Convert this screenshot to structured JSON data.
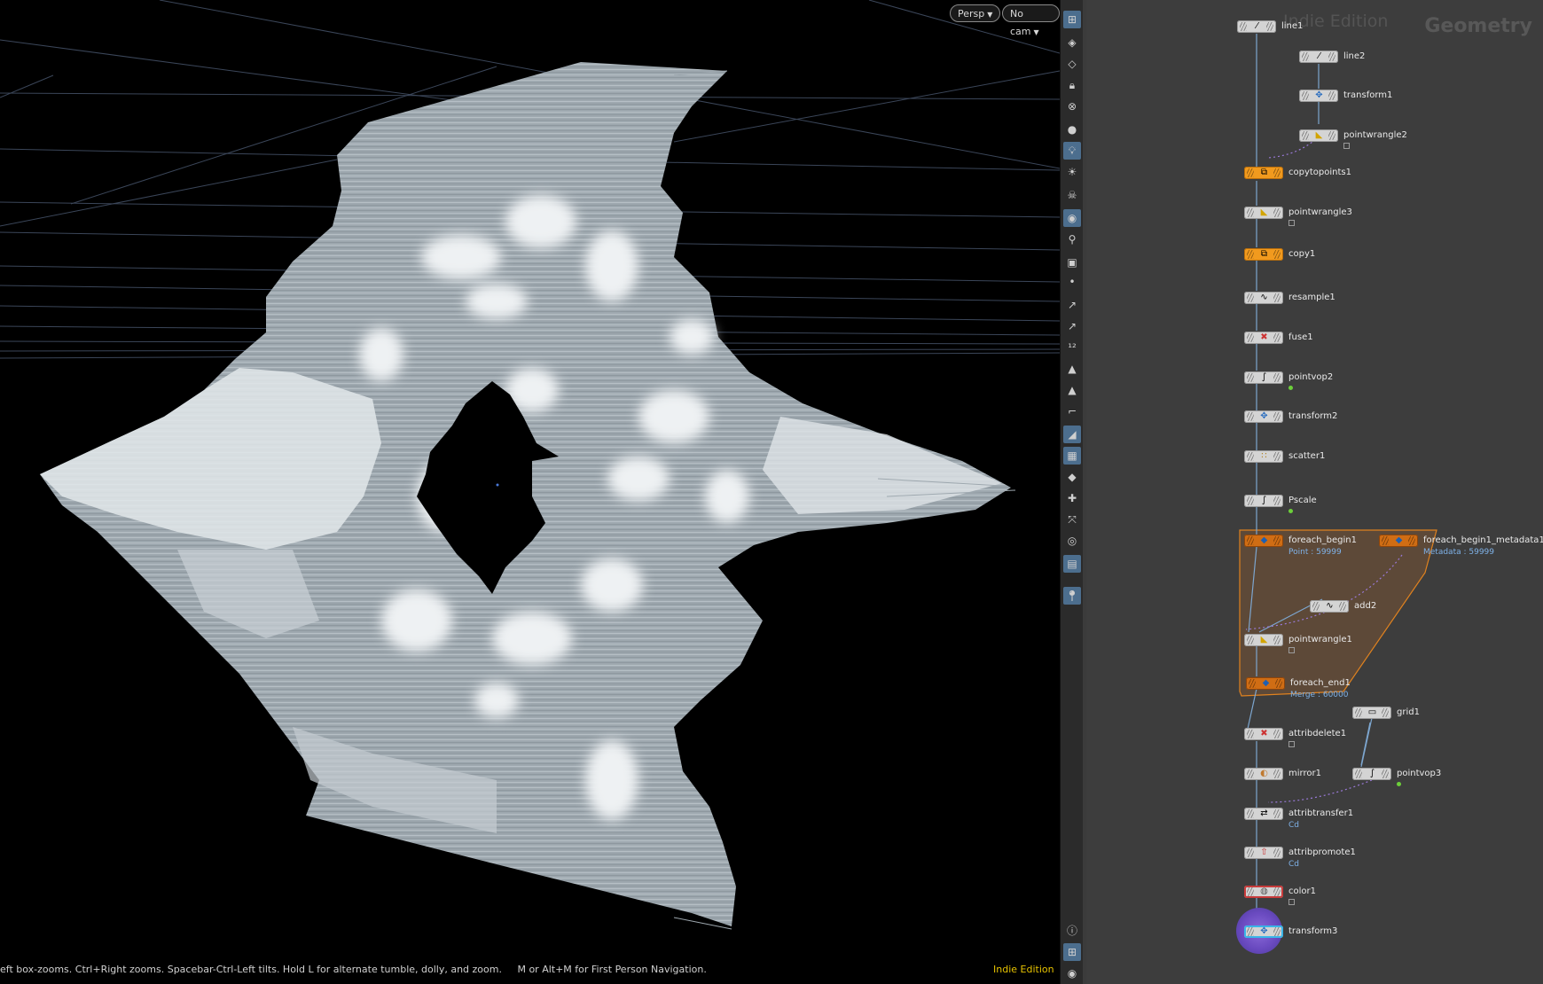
{
  "viewport": {
    "persp_label": "Persp",
    "cam_label": "No cam",
    "status_hint": "eft box-zooms. Ctrl+Right zooms. Spacebar-Ctrl-Left tilts. Hold L for alternate tumble, dolly, and zoom.     M or Alt+M for First Person Navigation.",
    "edition": "Indie Edition"
  },
  "network": {
    "title": "Geometry",
    "watermark": "Indie Edition",
    "nodes": {
      "line1": {
        "label": "line1"
      },
      "line2": {
        "label": "line2"
      },
      "transform1": {
        "label": "transform1"
      },
      "pointwrangle2": {
        "label": "pointwrangle2"
      },
      "copytopoints1": {
        "label": "copytopoints1"
      },
      "pointwrangle3": {
        "label": "pointwrangle3"
      },
      "copy1": {
        "label": "copy1"
      },
      "resample1": {
        "label": "resample1"
      },
      "fuse1": {
        "label": "fuse1"
      },
      "pointvop2": {
        "label": "pointvop2"
      },
      "transform2": {
        "label": "transform2"
      },
      "scatter1": {
        "label": "scatter1"
      },
      "pscale": {
        "label": "Pscale"
      },
      "foreach_begin1": {
        "label": "foreach_begin1",
        "sub": "Point : 59999"
      },
      "foreach_begin1_metadata1": {
        "label": "foreach_begin1_metadata1",
        "sub": "Metadata : 59999"
      },
      "add2": {
        "label": "add2"
      },
      "pointwrangle1": {
        "label": "pointwrangle1"
      },
      "foreach_end1": {
        "label": "foreach_end1",
        "sub": "Merge : 60000"
      },
      "grid1": {
        "label": "grid1"
      },
      "attribdelete1": {
        "label": "attribdelete1"
      },
      "mirror1": {
        "label": "mirror1"
      },
      "pointvop3": {
        "label": "pointvop3"
      },
      "attribtransfer1": {
        "label": "attribtransfer1",
        "sub": "Cd"
      },
      "attribpromote1": {
        "label": "attribpromote1",
        "sub": "Cd"
      },
      "color1": {
        "label": "color1"
      },
      "transform3": {
        "label": "transform3"
      }
    }
  }
}
